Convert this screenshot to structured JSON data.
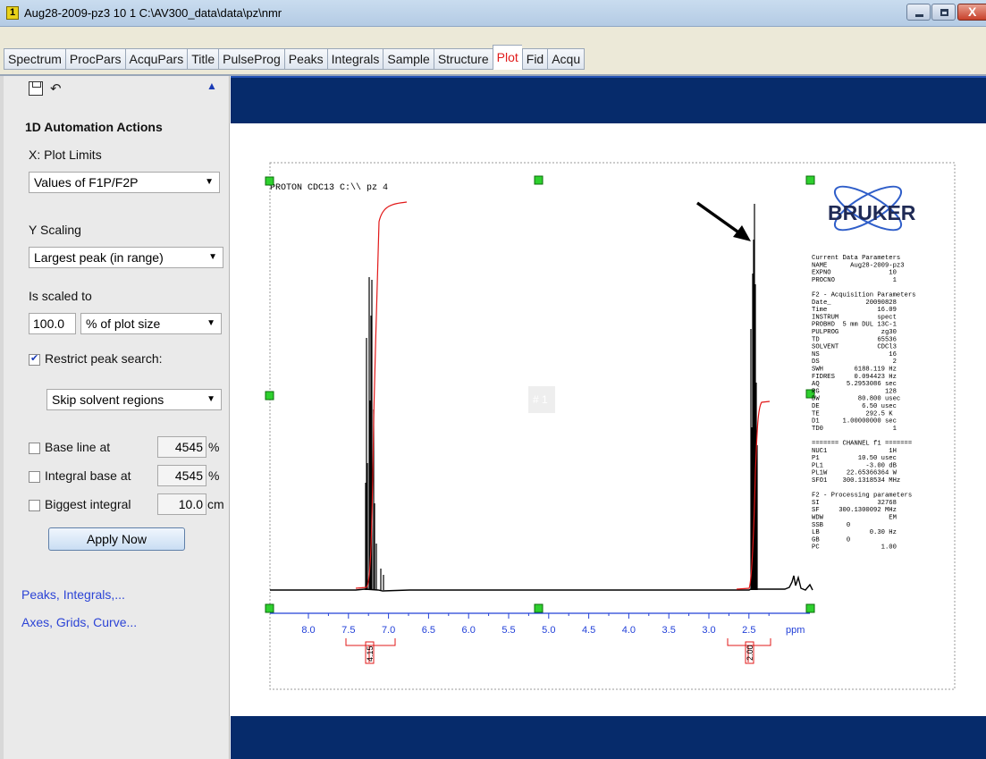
{
  "window": {
    "badge": "1",
    "title": "Aug28-2009-pz3 10 1  C:\\AV300_data\\data\\pz\\nmr",
    "close_glyph": "X"
  },
  "tabs": [
    {
      "label": "Spectrum"
    },
    {
      "label": "ProcPars"
    },
    {
      "label": "AcquPars"
    },
    {
      "label": "Title"
    },
    {
      "label": "PulseProg"
    },
    {
      "label": "Peaks"
    },
    {
      "label": "Integrals"
    },
    {
      "label": "Sample"
    },
    {
      "label": "Structure"
    },
    {
      "label": "Plot",
      "active": true
    },
    {
      "label": "Fid"
    },
    {
      "label": "Acqu"
    }
  ],
  "panel": {
    "section_title": "1D Automation Actions",
    "x_limits_label": "X: Plot Limits",
    "x_limits_value": "Values of F1P/F2P",
    "y_scaling_label": "Y Scaling",
    "y_scaling_value": "Largest peak (in range)",
    "scaled_to_label": "Is scaled to",
    "scaled_value": "100.0",
    "scaled_unit": "% of plot size",
    "restrict_label": "Restrict peak search:",
    "restrict_checked": true,
    "skip_value": "Skip solvent regions",
    "baseline_label": "Base line at",
    "baseline_value": "4545",
    "baseline_unit": "%",
    "intbase_label": "Integral base at",
    "intbase_value": "4545",
    "intbase_unit": "%",
    "bigint_label": "Biggest integral",
    "bigint_value": "10.0",
    "bigint_unit": "cm",
    "apply_label": "Apply Now",
    "link_peaks": "Peaks, Integrals,...",
    "link_axes": "Axes, Grids, Curve..."
  },
  "plot": {
    "spectrum_title": "PROTON CDC13 C:\\\\ pz 4",
    "watermark": "# 1",
    "logo_text": "BRUKER",
    "x_ticks": [
      "8.0",
      "7.5",
      "7.0",
      "6.5",
      "6.0",
      "5.5",
      "5.0",
      "4.5",
      "4.0",
      "3.5",
      "3.0",
      "2.5"
    ],
    "x_unit": "ppm",
    "integral_labels": [
      "4.15",
      "2.00"
    ],
    "params": [
      "Current Data Parameters",
      "NAME      Aug28-2009-pz3",
      "EXPNO               10",
      "PROCNO               1",
      "",
      "F2 - Acquisition Parameters",
      "Date_         20090828",
      "Time             16.09",
      "INSTRUM          spect",
      "PROBHD  5 mm DUL 13C-1",
      "PULPROG           zg30",
      "TD               65536",
      "SOLVENT          CDCl3",
      "NS                  16",
      "DS                   2",
      "SWH        6188.119 Hz",
      "FIDRES     0.094423 Hz",
      "AQ       5.2953086 sec",
      "RG                 128",
      "DW          80.800 usec",
      "DE           6.50 usec",
      "TE            292.5 K",
      "D1      1.00000000 sec",
      "TD0                  1",
      "",
      "======= CHANNEL f1 =======",
      "NUC1                1H",
      "P1          10.50 usec",
      "PL1           -3.00 dB",
      "PL1W     22.65366364 W",
      "SFO1    300.1318534 MHz",
      "",
      "F2 - Processing parameters",
      "SI               32768",
      "SF     300.1300092 MHz",
      "WDW                 EM",
      "SSB      0",
      "LB             0.30 Hz",
      "GB       0",
      "PC                1.00"
    ]
  }
}
